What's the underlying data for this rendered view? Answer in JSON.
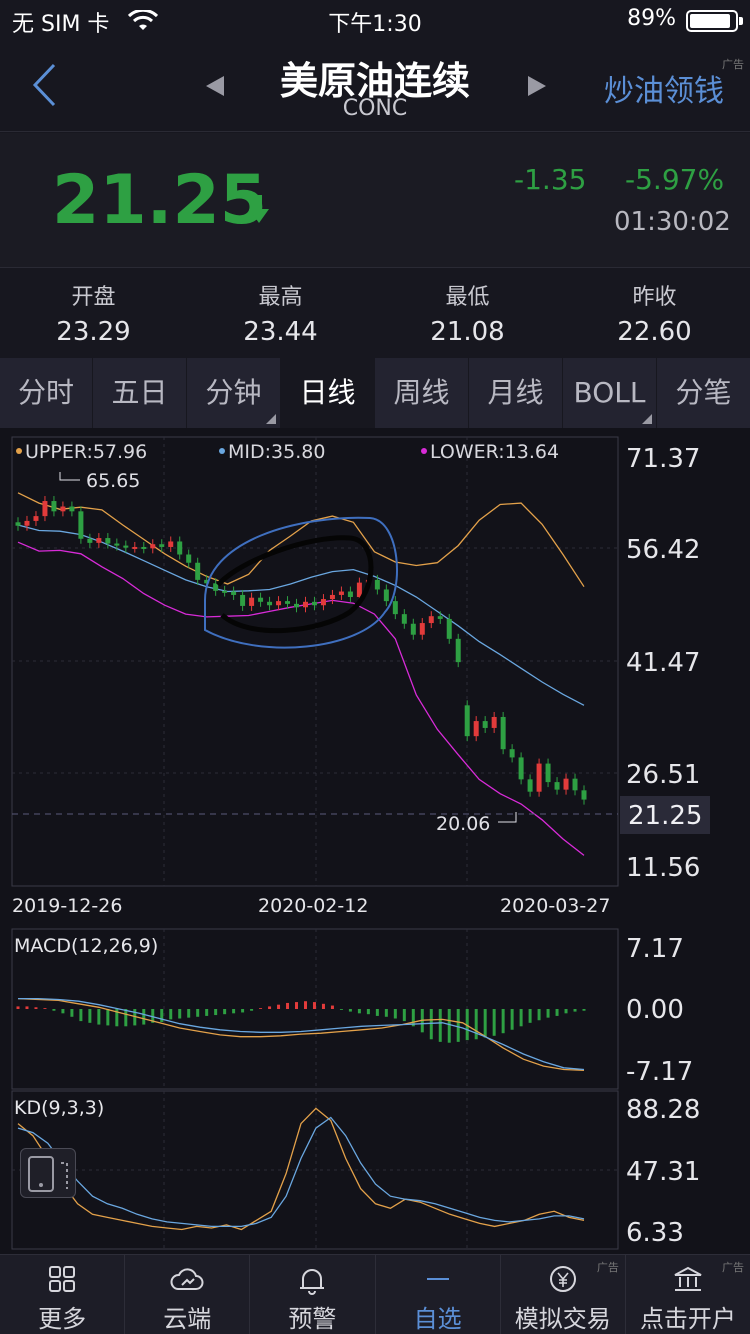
{
  "status_bar": {
    "carrier": "无 SIM 卡",
    "time": "下午1:30",
    "battery": "89%"
  },
  "nav": {
    "title": "美原油连续",
    "subtitle": "CONC",
    "action": "炒油领钱",
    "ad_mark": "广告"
  },
  "quote": {
    "price": "21.25",
    "change": "-1.35",
    "change_pct": "-5.97%",
    "time": "01:30:02"
  },
  "stats": [
    {
      "label": "开盘",
      "value": "23.29"
    },
    {
      "label": "最高",
      "value": "23.44"
    },
    {
      "label": "最低",
      "value": "21.08"
    },
    {
      "label": "昨收",
      "value": "22.60"
    }
  ],
  "tabs": [
    {
      "label": "分时",
      "active": false,
      "dropdown": false
    },
    {
      "label": "五日",
      "active": false,
      "dropdown": false
    },
    {
      "label": "分钟",
      "active": false,
      "dropdown": true
    },
    {
      "label": "日线",
      "active": true,
      "dropdown": false
    },
    {
      "label": "周线",
      "active": false,
      "dropdown": false
    },
    {
      "label": "月线",
      "active": false,
      "dropdown": false
    },
    {
      "label": "BOLL",
      "active": false,
      "dropdown": true
    },
    {
      "label": "分笔",
      "active": false,
      "dropdown": false
    }
  ],
  "chart": {
    "legend": {
      "upper": "UPPER:57.96",
      "mid": "MID:35.80",
      "lower": "LOWER:13.64"
    },
    "y_ticks": [
      "71.37",
      "56.42",
      "41.47",
      "26.51",
      "11.56"
    ],
    "current_price": "21.25",
    "high_marker": "65.65",
    "low_marker": "20.06",
    "x_ticks": [
      "2019-12-26",
      "2020-02-12",
      "2020-03-27"
    ],
    "macd_label": "MACD(12,26,9)",
    "macd_ticks": [
      "7.17",
      "0.00",
      "-7.17"
    ],
    "kd_label": "KD(9,3,3)",
    "kd_ticks": [
      "88.28",
      "47.31",
      "6.33"
    ],
    "colors": {
      "up": "#e23b3b",
      "down": "#2ea043",
      "upper": "#e3a14a",
      "mid": "#6aa7e0",
      "lower": "#d82bd8",
      "k": "#e3a14a",
      "d": "#6aa7e0"
    }
  },
  "chart_data": {
    "type": "candlestick",
    "dates_shown": [
      "2019-12-26",
      "2020-02-12",
      "2020-03-27"
    ],
    "candles": [
      {
        "o": 61.7,
        "c": 61.2
      },
      {
        "o": 61.2,
        "c": 61.9
      },
      {
        "o": 61.9,
        "c": 62.6
      },
      {
        "o": 62.6,
        "c": 64.8
      },
      {
        "o": 64.8,
        "c": 63.3
      },
      {
        "o": 63.3,
        "c": 64.0
      },
      {
        "o": 64.0,
        "c": 63.3
      },
      {
        "o": 63.3,
        "c": 59.3
      },
      {
        "o": 59.3,
        "c": 58.7
      },
      {
        "o": 58.7,
        "c": 59.4
      },
      {
        "o": 59.4,
        "c": 58.6
      },
      {
        "o": 58.6,
        "c": 58.3
      },
      {
        "o": 58.3,
        "c": 58.0
      },
      {
        "o": 58.0,
        "c": 58.1
      },
      {
        "o": 58.1,
        "c": 57.9
      },
      {
        "o": 57.9,
        "c": 58.5
      },
      {
        "o": 58.5,
        "c": 58.1
      },
      {
        "o": 58.1,
        "c": 58.9
      },
      {
        "o": 58.9,
        "c": 57.0
      },
      {
        "o": 57.0,
        "c": 55.8
      },
      {
        "o": 55.8,
        "c": 53.3
      },
      {
        "o": 53.3,
        "c": 52.8
      },
      {
        "o": 52.8,
        "c": 51.7
      },
      {
        "o": 51.7,
        "c": 51.6
      },
      {
        "o": 51.6,
        "c": 51.1
      },
      {
        "o": 51.1,
        "c": 49.5
      },
      {
        "o": 49.5,
        "c": 50.7
      },
      {
        "o": 50.7,
        "c": 50.1
      },
      {
        "o": 50.1,
        "c": 49.6
      },
      {
        "o": 49.6,
        "c": 50.2
      },
      {
        "o": 50.2,
        "c": 49.8
      },
      {
        "o": 49.8,
        "c": 49.3
      },
      {
        "o": 49.3,
        "c": 50.1
      },
      {
        "o": 50.1,
        "c": 49.6
      },
      {
        "o": 49.6,
        "c": 50.5
      },
      {
        "o": 50.5,
        "c": 51.1
      },
      {
        "o": 51.1,
        "c": 51.6
      },
      {
        "o": 51.6,
        "c": 50.8
      },
      {
        "o": 50.8,
        "c": 52.9
      },
      {
        "o": 52.9,
        "c": 53.3
      },
      {
        "o": 53.3,
        "c": 51.9
      },
      {
        "o": 51.9,
        "c": 50.2
      },
      {
        "o": 50.2,
        "c": 48.3
      },
      {
        "o": 48.3,
        "c": 46.9
      },
      {
        "o": 46.9,
        "c": 45.3
      },
      {
        "o": 45.3,
        "c": 47.0
      },
      {
        "o": 47.0,
        "c": 48.0
      },
      {
        "o": 48.0,
        "c": 47.6
      },
      {
        "o": 47.6,
        "c": 44.7
      },
      {
        "o": 44.7,
        "c": 41.3
      },
      {
        "o": 35.0,
        "c": 30.5
      },
      {
        "o": 30.5,
        "c": 32.7
      },
      {
        "o": 32.7,
        "c": 31.7
      },
      {
        "o": 31.7,
        "c": 33.3
      },
      {
        "o": 33.3,
        "c": 28.6
      },
      {
        "o": 28.6,
        "c": 27.4
      },
      {
        "o": 27.4,
        "c": 24.2
      },
      {
        "o": 24.2,
        "c": 22.4
      },
      {
        "o": 22.4,
        "c": 26.5
      },
      {
        "o": 26.5,
        "c": 23.8
      },
      {
        "o": 23.8,
        "c": 22.7
      },
      {
        "o": 22.7,
        "c": 24.3
      },
      {
        "o": 24.3,
        "c": 22.6
      },
      {
        "o": 22.6,
        "c": 21.25
      }
    ],
    "ylim": [
      11.56,
      71.37
    ],
    "boll": {
      "upper": [
        66.0,
        64.5,
        63.6,
        63.9,
        63.5,
        61.3,
        59.2,
        57.1,
        55.3,
        53.8,
        52.7,
        54.1,
        57.6,
        59.7,
        61.9,
        62.6,
        61.7,
        57.4,
        55.9,
        55.4,
        55.8,
        58.3,
        62.0,
        64.3,
        64.5,
        61.4,
        57.0,
        52.3
      ],
      "mid": [
        61.3,
        60.5,
        60.4,
        59.9,
        58.8,
        57.5,
        56.1,
        54.7,
        53.3,
        52.3,
        51.6,
        51.7,
        51.9,
        52.7,
        53.7,
        54.5,
        54.8,
        53.8,
        52.5,
        50.8,
        48.7,
        46.6,
        44.3,
        42.4,
        40.4,
        38.4,
        36.6,
        35.0
      ],
      "lower": [
        58.8,
        57.5,
        57.6,
        57.1,
        55.2,
        53.5,
        51.3,
        49.6,
        48.3,
        47.9,
        48.0,
        48.1,
        48.7,
        49.3,
        49.8,
        50.3,
        49.9,
        48.3,
        44.7,
        36.5,
        31.5,
        27.8,
        24.2,
        22.1,
        20.6,
        18.3,
        15.5,
        13.1
      ]
    },
    "macd": {
      "ylim": [
        -7.17,
        7.17
      ],
      "hist": [
        0.3,
        0.3,
        0.2,
        0.1,
        -0.2,
        -0.5,
        -0.9,
        -1.4,
        -1.6,
        -1.8,
        -1.9,
        -2.0,
        -2.0,
        -1.9,
        -1.8,
        -1.6,
        -1.5,
        -1.2,
        -1.1,
        -1.0,
        -0.9,
        -0.8,
        -0.7,
        -0.6,
        -0.5,
        -0.4,
        -0.2,
        0.1,
        0.3,
        0.5,
        0.7,
        0.8,
        0.9,
        0.8,
        0.6,
        0.4,
        -0.1,
        -0.3,
        -0.5,
        -0.6,
        -0.8,
        -0.9,
        -1.1,
        -1.4,
        -2.0,
        -2.7,
        -3.5,
        -3.8,
        -3.9,
        -3.8,
        -3.6,
        -3.5,
        -3.3,
        -3.1,
        -2.8,
        -2.4,
        -2.0,
        -1.6,
        -1.3,
        -1.0,
        -0.8,
        -0.5,
        -0.3,
        -0.2
      ],
      "dif": [
        1.2,
        1.1,
        1.0,
        0.6,
        0.2,
        -0.4,
        -1.0,
        -1.6,
        -2.2,
        -2.6,
        -3.0,
        -3.2,
        -3.2,
        -3.1,
        -2.9,
        -2.8,
        -2.6,
        -2.4,
        -2.2,
        -1.8,
        -1.3,
        -1.2,
        -1.6,
        -3.0,
        -4.5,
        -5.8,
        -6.6,
        -7.0,
        -7.1
      ],
      "dea": [
        1.2,
        1.2,
        1.1,
        0.9,
        0.5,
        0.0,
        -0.5,
        -1.1,
        -1.7,
        -2.1,
        -2.4,
        -2.6,
        -2.7,
        -2.7,
        -2.6,
        -2.4,
        -2.2,
        -2.0,
        -1.9,
        -1.8,
        -1.7,
        -1.6,
        -2.2,
        -3.1,
        -4.1,
        -5.2,
        -6.1,
        -6.8,
        -7.0
      ]
    },
    "kd": {
      "ylim": [
        6.33,
        88.28
      ],
      "k": [
        78,
        70,
        55,
        38,
        25,
        18,
        16,
        14,
        12,
        10,
        9,
        8,
        10,
        9,
        11,
        8,
        14,
        20,
        45,
        78,
        88,
        80,
        55,
        35,
        25,
        22,
        28,
        26,
        22,
        18,
        15,
        12,
        10,
        12,
        14,
        18,
        20,
        16,
        14
      ],
      "d": [
        75,
        72,
        65,
        52,
        40,
        30,
        25,
        22,
        18,
        15,
        13,
        12,
        11,
        10,
        10,
        10,
        12,
        16,
        30,
        55,
        75,
        82,
        70,
        52,
        38,
        30,
        28,
        27,
        25,
        22,
        19,
        16,
        14,
        13,
        14,
        15,
        17,
        17,
        15
      ]
    }
  },
  "bottom_bar": [
    {
      "label": "更多",
      "icon": "grid-icon",
      "active": false,
      "ad": ""
    },
    {
      "label": "云端",
      "icon": "cloud-icon",
      "active": false,
      "ad": ""
    },
    {
      "label": "预警",
      "icon": "bell-icon",
      "active": false,
      "ad": ""
    },
    {
      "label": "自选",
      "icon": "dash-icon",
      "active": true,
      "ad": ""
    },
    {
      "label": "模拟交易",
      "icon": "yen-icon",
      "active": false,
      "ad": "广告"
    },
    {
      "label": "点击开户",
      "icon": "bank-icon",
      "active": false,
      "ad": "广告"
    }
  ]
}
